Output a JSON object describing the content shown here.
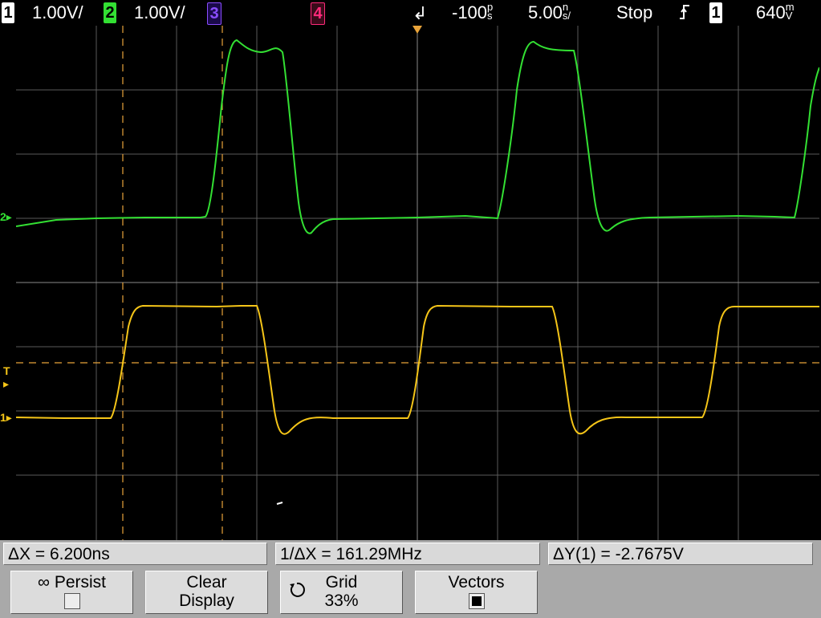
{
  "topbar": {
    "ch1_label": "1",
    "ch1_scale": "1.00V/",
    "ch2_label": "2",
    "ch2_scale": "1.00V/",
    "ch3_label": "3",
    "ch4_label": "4",
    "delay": "-100",
    "delay_unit": "p\ns",
    "timebase": "5.00",
    "timebase_unit": "n\ns/",
    "run_state": "Stop",
    "trigger_slope_icon": "rising-edge-icon",
    "trigger_source": "1",
    "trigger_level": "640",
    "trigger_level_unit": "m\nV"
  },
  "markers": {
    "ch2": "2",
    "trig": "T",
    "ch1": "1"
  },
  "measurements": {
    "delta_x": "ΔX = 6.200ns",
    "inv_delta_x": "1/ΔX = 161.29MHz",
    "delta_y": "ΔY(1) = -2.7675V"
  },
  "softkeys": {
    "persist_label": "Persist",
    "persist_icon": "infinity-icon",
    "clear_line1": "Clear",
    "clear_line2": "Display",
    "grid_label": "Grid",
    "grid_value": "33%",
    "grid_icon": "rotate-knob-icon",
    "vectors_label": "Vectors"
  },
  "colors": {
    "ch1": "#f5c518",
    "ch2": "#33e033",
    "ch3": "#8a4dff",
    "ch4": "#ff2a7a",
    "cursor": "#e8a33a",
    "grid": "#5a5a5a"
  }
}
